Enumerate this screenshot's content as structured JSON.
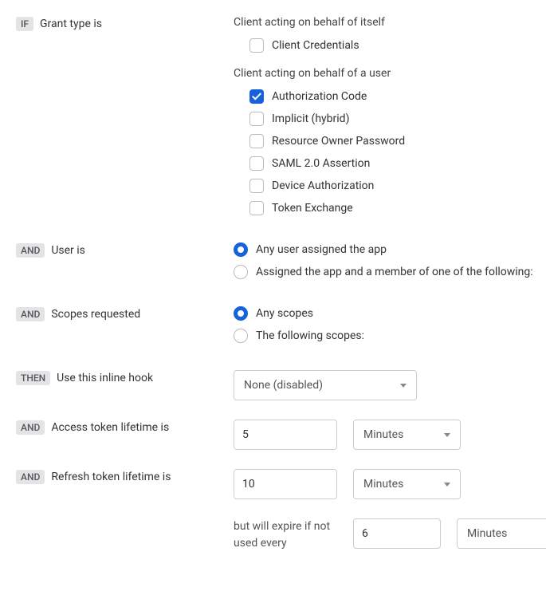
{
  "tags": {
    "if": "IF",
    "and": "AND",
    "then": "THEN"
  },
  "labels": {
    "grant_type": "Grant type is",
    "user_is": "User is",
    "scopes": "Scopes requested",
    "inline_hook": "Use this inline hook",
    "access_token": "Access token lifetime is",
    "refresh_token": "Refresh token lifetime is"
  },
  "grant": {
    "heading_self": "Client acting on behalf of itself",
    "heading_user": "Client acting on behalf of a user",
    "client_credentials": "Client Credentials",
    "authorization_code": "Authorization Code",
    "implicit": "Implicit (hybrid)",
    "resource_owner": "Resource Owner Password",
    "saml": "SAML 2.0 Assertion",
    "device_auth": "Device Authorization",
    "token_exchange": "Token Exchange"
  },
  "user": {
    "any": "Any user assigned the app",
    "member": "Assigned the app and a member of one of the following:"
  },
  "scopes": {
    "any": "Any scopes",
    "following": "The following scopes:"
  },
  "hook": {
    "value": "None (disabled)"
  },
  "access": {
    "value": "5",
    "unit": "Minutes"
  },
  "refresh": {
    "value": "10",
    "unit": "Minutes"
  },
  "expire": {
    "prefix": "but will expire if not used every",
    "value": "6",
    "unit": "Minutes"
  }
}
